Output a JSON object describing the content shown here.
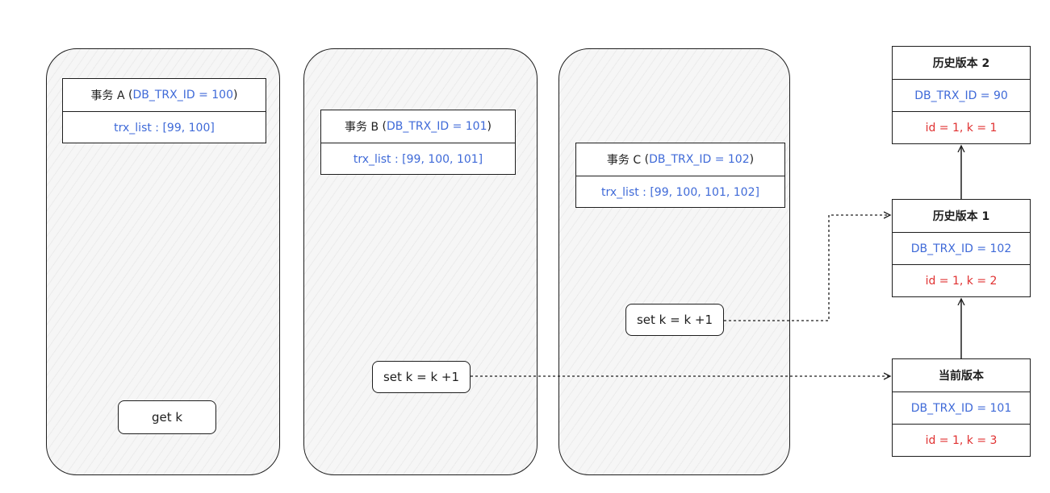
{
  "transactions": {
    "a": {
      "label": "事务 A",
      "id_text": "DB_TRX_ID = 100",
      "trx_list": "trx_list : [99, 100]"
    },
    "b": {
      "label": "事务 B",
      "id_text": "DB_TRX_ID = 101",
      "trx_list": "trx_list : [99, 100, 101]"
    },
    "c": {
      "label": "事务 C",
      "id_text": "DB_TRX_ID = 102",
      "trx_list": "trx_list : [99, 100, 101, 102]"
    }
  },
  "operations": {
    "a": "get k",
    "b": "set k = k +1",
    "c": "set k = k +1"
  },
  "versions": {
    "history2": {
      "title": "历史版本 2",
      "trx_id": "DB_TRX_ID = 90",
      "row": "id = 1, k = 1"
    },
    "history1": {
      "title": "历史版本 1",
      "trx_id": "DB_TRX_ID = 102",
      "row": "id = 1, k = 2"
    },
    "current": {
      "title": "当前版本",
      "trx_id": "DB_TRX_ID = 101",
      "row": "id = 1, k = 3"
    }
  },
  "colors": {
    "id_blue": "#3f6ad8",
    "row_red": "#e03131",
    "stroke": "#1e1e1e"
  }
}
